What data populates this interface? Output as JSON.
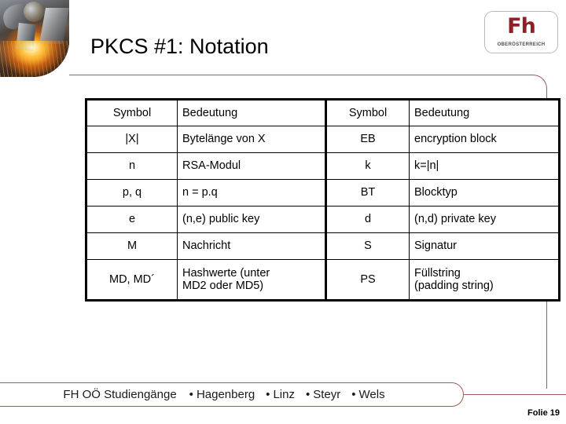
{
  "slide": {
    "title": "PKCS #1: Notation",
    "number_label": "Folie 19"
  },
  "logo": {
    "mark": "Fh",
    "subtitle": "OBERÖSTERREICH",
    "color": "#8e2026"
  },
  "hero_image": {
    "name": "welding-machine-sparks-photo"
  },
  "table": {
    "headers": {
      "symbol_left": "Symbol",
      "meaning_left": "Bedeutung",
      "symbol_right": "Symbol",
      "meaning_right": "Bedeutung"
    },
    "rows": [
      {
        "symbol_left": "|X|",
        "meaning_left": "Bytelänge von X",
        "symbol_right": "EB",
        "meaning_right": "encryption block"
      },
      {
        "symbol_left": "n",
        "meaning_left": "RSA-Modul",
        "symbol_right": "k",
        "meaning_right": "k=|n|"
      },
      {
        "symbol_left": "p, q",
        "meaning_left": "n = p.q",
        "symbol_right": "BT",
        "meaning_right": "Blocktyp"
      },
      {
        "symbol_left": "e",
        "meaning_left": "(n,e) public key",
        "symbol_right": "d",
        "meaning_right": "(n,d) private key"
      },
      {
        "symbol_left": "M",
        "meaning_left": "Nachricht",
        "symbol_right": "S",
        "meaning_right": "Signatur"
      },
      {
        "symbol_left": "MD, MD´",
        "meaning_left": "Hashwerte (unter\nMD2 oder MD5)",
        "symbol_right": "PS",
        "meaning_right": "Füllstring\n(padding string)"
      }
    ]
  },
  "footer": {
    "brand": "FH OÖ Studiengänge",
    "separator": "•",
    "campuses": [
      "Hagenberg",
      "Linz",
      "Steyr",
      "Wels"
    ],
    "accent_color": "#9d5b5b"
  }
}
